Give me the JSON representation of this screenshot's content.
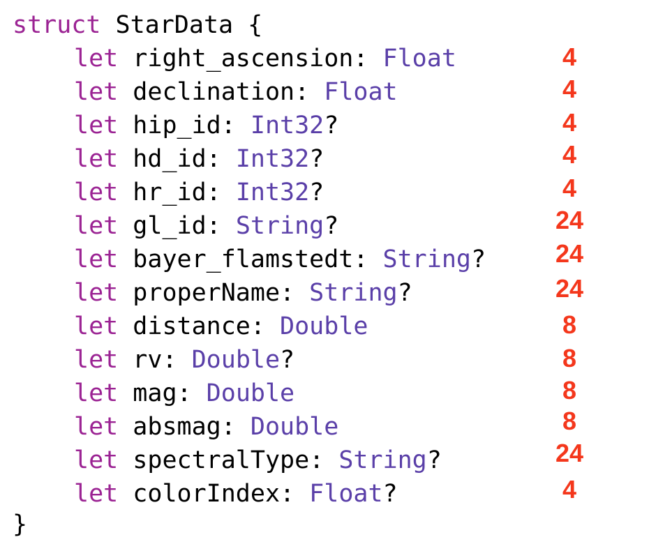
{
  "colors": {
    "keyword": "#9b2393",
    "type": "#5a3fa8",
    "text": "#000000",
    "annotation": "#f4371c",
    "background": "#ffffff"
  },
  "header": {
    "keyword": "struct",
    "name": "StarData",
    "open_brace": "{"
  },
  "fields": [
    {
      "kw": "let",
      "name": "right_ascension",
      "colon": ": ",
      "type": "Float",
      "optional": "",
      "size": "4"
    },
    {
      "kw": "let",
      "name": "declination",
      "colon": ": ",
      "type": "Float",
      "optional": "",
      "size": "4"
    },
    {
      "kw": "let",
      "name": "hip_id",
      "colon": ": ",
      "type": "Int32",
      "optional": "?",
      "size": "4"
    },
    {
      "kw": "let",
      "name": "hd_id",
      "colon": ": ",
      "type": "Int32",
      "optional": "?",
      "size": "4"
    },
    {
      "kw": "let",
      "name": "hr_id",
      "colon": ": ",
      "type": "Int32",
      "optional": "?",
      "size": "4"
    },
    {
      "kw": "let",
      "name": "gl_id",
      "colon": ": ",
      "type": "String",
      "optional": "?",
      "size": "24"
    },
    {
      "kw": "let",
      "name": "bayer_flamstedt",
      "colon": ": ",
      "type": "String",
      "optional": "?",
      "size": "24"
    },
    {
      "kw": "let",
      "name": "properName",
      "colon": ": ",
      "type": "String",
      "optional": "?",
      "size": "24"
    },
    {
      "kw": "let",
      "name": "distance",
      "colon": ": ",
      "type": "Double",
      "optional": "",
      "size": "8"
    },
    {
      "kw": "let",
      "name": "rv",
      "colon": ": ",
      "type": "Double",
      "optional": "?",
      "size": "8"
    },
    {
      "kw": "let",
      "name": "mag",
      "colon": ": ",
      "type": "Double",
      "optional": "",
      "size": "8"
    },
    {
      "kw": "let",
      "name": "absmag",
      "colon": ": ",
      "type": "Double",
      "optional": "",
      "size": "8"
    },
    {
      "kw": "let",
      "name": "spectralType",
      "colon": ": ",
      "type": "String",
      "optional": "?",
      "size": "24"
    },
    {
      "kw": "let",
      "name": "colorIndex",
      "colon": ": ",
      "type": "Float",
      "optional": "?",
      "size": "4"
    }
  ],
  "footer": {
    "close_brace": "}"
  }
}
